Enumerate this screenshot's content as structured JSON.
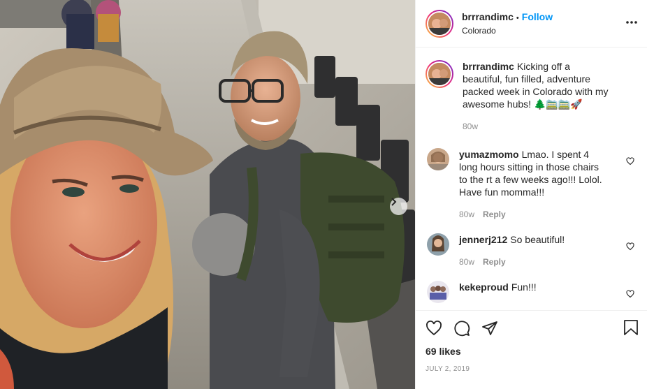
{
  "post": {
    "username": "brrrandimc",
    "follow_label": "Follow",
    "separator": "•",
    "location": "Colorado"
  },
  "caption": {
    "username": "brrrandimc",
    "text": "Kicking off a beautiful, fun filled, adventure packed week in Colorado with my awesome hubs! 🌲🚞🚞🚀",
    "time": "80w"
  },
  "comments": [
    {
      "username": "yumazmomo",
      "text": "Lmao. I spent 4 long hours sitting in those chairs to the rt a few weeks ago!!! Lolol. Have fun momma!!!",
      "time": "80w",
      "reply": "Reply"
    },
    {
      "username": "jennerj212",
      "text": "So beautiful!",
      "time": "80w",
      "reply": "Reply"
    },
    {
      "username": "kekeproud",
      "text": "Fun!!!"
    }
  ],
  "likes": "69 likes",
  "date": "JULY 2, 2019",
  "icons": {
    "more": "more-options-icon",
    "next": "chevron-right-icon",
    "like": "heart-icon",
    "comment": "comment-bubble-icon",
    "share": "paper-plane-icon",
    "save": "bookmark-icon",
    "comment_like": "heart-icon"
  },
  "colors": {
    "accent": "#0095f6",
    "muted": "#8e8e8e",
    "text": "#262626",
    "border": "#efefef"
  }
}
